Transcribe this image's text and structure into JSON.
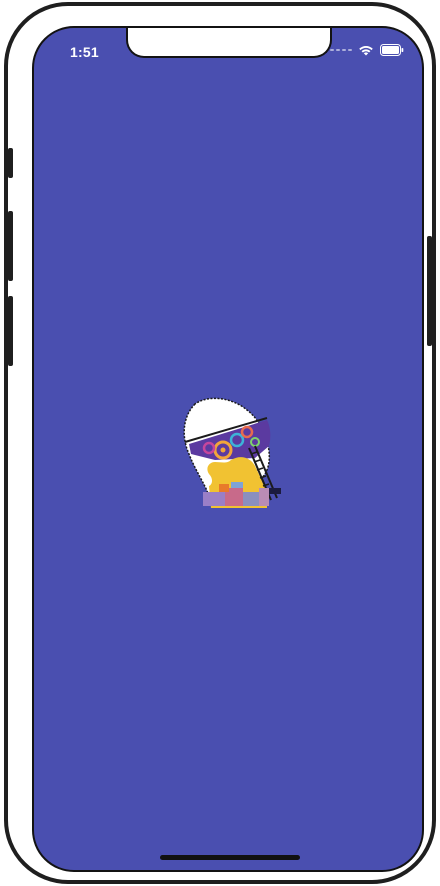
{
  "status_bar": {
    "time": "1:51",
    "signal_icon": "signal-dots-icon",
    "wifi_icon": "wifi-icon",
    "battery_icon": "battery-icon"
  },
  "splash": {
    "background_color": "#4a4fb0",
    "logo_icon": "head-gears-logo",
    "faint_text": ""
  }
}
